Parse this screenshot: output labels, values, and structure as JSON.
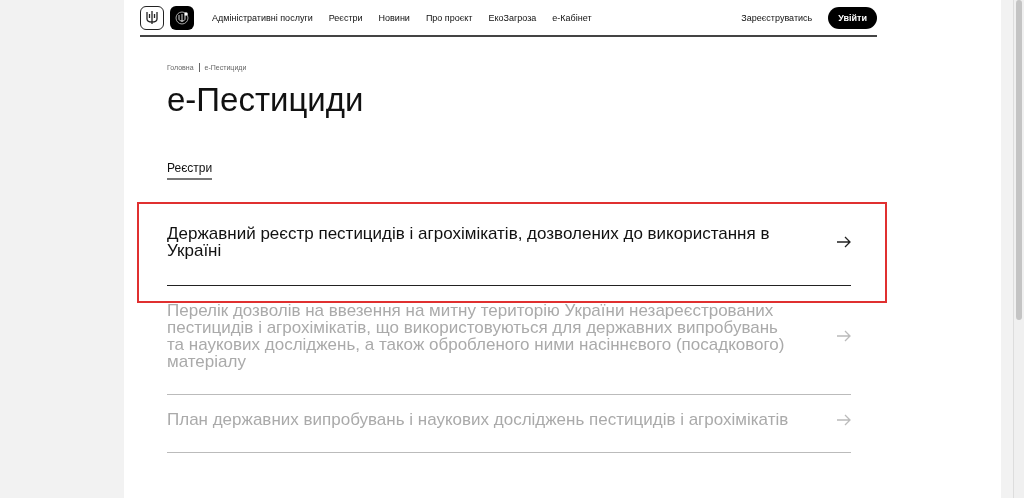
{
  "header": {
    "nav": [
      {
        "label": "Адміністративні послуги"
      },
      {
        "label": "Реєстри"
      },
      {
        "label": "Новини"
      },
      {
        "label": "Про проєкт"
      },
      {
        "label": "ЕкоЗагроза"
      },
      {
        "label": "е-Кабінет"
      }
    ],
    "register": "Зареєструватись",
    "login": "Увійти"
  },
  "breadcrumbs": [
    "Головна",
    "е-Пестициди"
  ],
  "title": "е-Пестициди",
  "tabs": [
    {
      "label": "Реєстри",
      "selected": true
    }
  ],
  "registries": [
    {
      "title": "Державний реєстр пестицидів і агрохімікатів, дозволених до використання в Україні",
      "disabled": false,
      "highlighted": true
    },
    {
      "title": "Перелік дозволів на ввезення на митну територію України незареєстрованих пестицидів і агрохімікатів, що використовуються для державних випробувань та наукових досліджень, а також обробленого ними насіннєвого (посадкового) матеріалу",
      "disabled": true,
      "highlighted": false
    },
    {
      "title": "План державних випробувань і наукових досліджень пестицидів і агрохімікатів",
      "disabled": true,
      "highlighted": false
    }
  ]
}
